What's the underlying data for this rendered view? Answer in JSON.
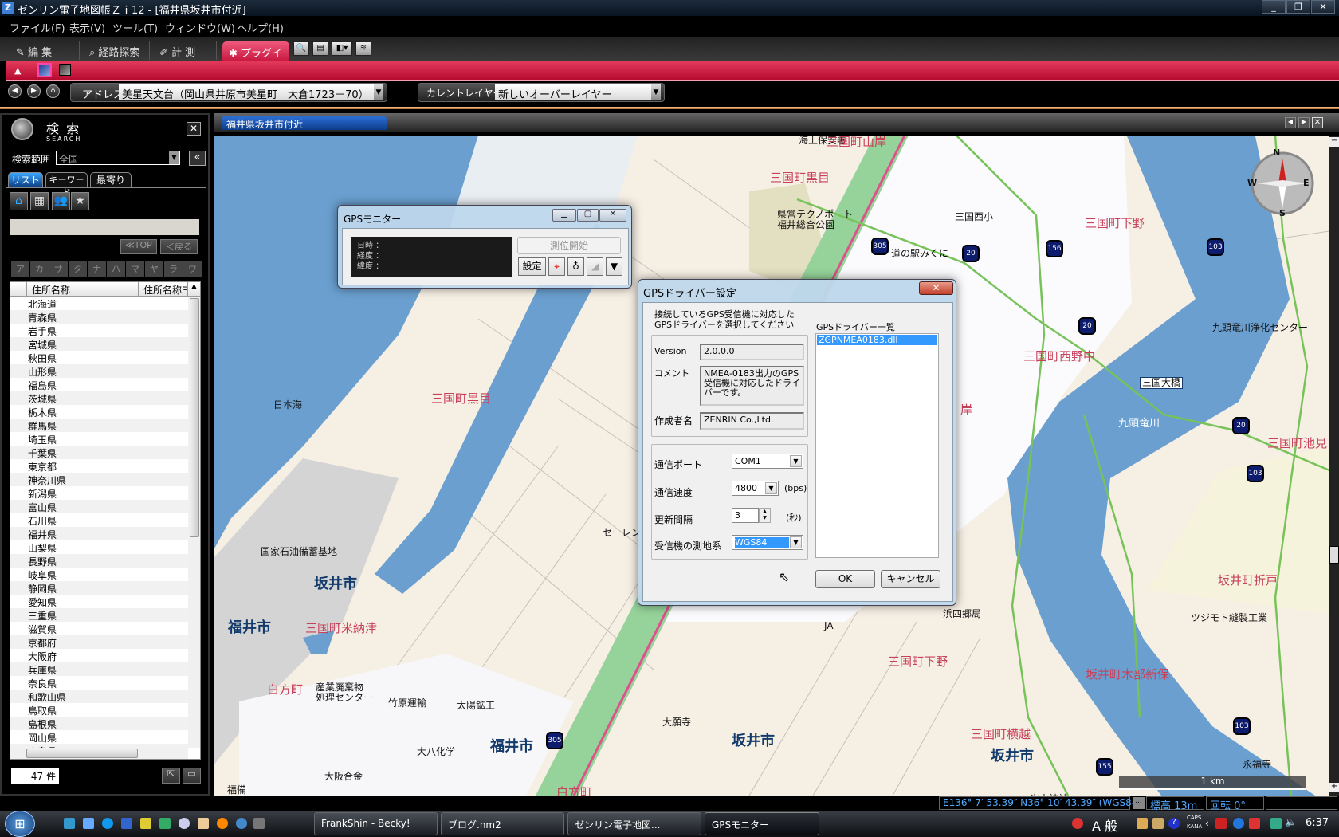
{
  "window": {
    "title": "ゼンリン電子地図帳Ｚｉ12 - [福井県坂井市付近]",
    "app_icon": "Z"
  },
  "menu": [
    "ファイル(F)",
    "表示(V)",
    "ツール(T)",
    "ウィンドウ(W)",
    "ヘルプ(H)"
  ],
  "toolbar": {
    "tabs": [
      "編 集",
      "経路探索",
      "計 測",
      "プラグイン"
    ],
    "active_tab": "プラグイン"
  },
  "address": {
    "label": "アドレス",
    "value": "美星天文台（岡山県井原市美星町　大倉1723－70）"
  },
  "layer": {
    "label": "カレントレイヤー",
    "value": "新しいオーバーレイヤー"
  },
  "search_panel": {
    "title": "検 索",
    "subtitle": "SEARCH",
    "scope_label": "検索範囲",
    "scope_value": "全国",
    "tabs": [
      "リスト",
      "キーワード",
      "最寄り"
    ],
    "top_button": "≪TOP",
    "back_button": "＜戻る",
    "kana": [
      "ア",
      "カ",
      "サ",
      "タ",
      "ナ",
      "ハ",
      "マ",
      "ヤ",
      "ラ",
      "ワ"
    ],
    "columns": [
      "住所名称",
      "住所名称ヨ"
    ],
    "rows": [
      "北海道",
      "青森県",
      "岩手県",
      "宮城県",
      "秋田県",
      "山形県",
      "福島県",
      "茨城県",
      "栃木県",
      "群馬県",
      "埼玉県",
      "千葉県",
      "東京都",
      "神奈川県",
      "新潟県",
      "富山県",
      "石川県",
      "福井県",
      "山梨県",
      "長野県",
      "岐阜県",
      "静岡県",
      "愛知県",
      "三重県",
      "滋賀県",
      "京都府",
      "大阪府",
      "兵庫県",
      "奈良県",
      "和歌山県",
      "鳥取県",
      "島根県",
      "岡山県",
      "広島県"
    ],
    "count": "47 件"
  },
  "map": {
    "tab": "福井県坂井市付近",
    "labels": [
      "海上保安署",
      "三国町山岸",
      "三国町黒目",
      "県営テクノポート",
      "福井総合公園",
      "道の駅みくに",
      "三国西小",
      "三国町下野",
      "九頭竜川浄化センター",
      "三国町西野中",
      "三国大橋",
      "九頭竜川",
      "三国町池見",
      "日本海",
      "三国町黒目",
      "国家石油備蓄基地",
      "セーレン電",
      "坂井市",
      "福井市",
      "三国町米納津",
      "白方町",
      "産業廃棄物",
      "処理センター",
      "竹原運輸",
      "太陽鉱工",
      "大八化学",
      "大阪合金",
      "福備",
      "福井市",
      "白方町",
      "大願寺",
      "坂井市",
      "三国町下野",
      "浜四郷局",
      "JA",
      "三国町横越",
      "坂井市",
      "坂井町折戸",
      "ツジモト縫製工業",
      "坂井町木部新保",
      "永福寺",
      "氷山神社",
      "岸"
    ],
    "route_shields": [
      "305",
      "20",
      "156",
      "103",
      "20",
      "20",
      "103",
      "103",
      "155",
      "305"
    ],
    "scale": "1 km",
    "compass": [
      "N",
      "E",
      "S",
      "W"
    ]
  },
  "gps_monitor": {
    "title": "GPSモニター",
    "fields": [
      "日時 ：",
      "経度 ：",
      "緯度 ："
    ],
    "start_button": "測位開始",
    "settings_button": "設定"
  },
  "driver_dialog": {
    "title": "GPSドライバー設定",
    "instruction": [
      "接続しているGPS受信機に対応した",
      "GPSドライバーを選択してください"
    ],
    "version_label": "Version",
    "version": "2.0.0.0",
    "comment_label": "コメント",
    "comment": "NMEA-0183出力のGPS受信機に対応したドライバーです。",
    "author_label": "作成者名",
    "author": "ZENRIN Co.,Ltd.",
    "port_label": "通信ポート",
    "port": "COM1",
    "speed_label": "通信速度",
    "speed": "4800",
    "speed_unit": "(bps)",
    "interval_label": "更新間隔",
    "interval": "3",
    "interval_unit": "(秒)",
    "datum_label": "受信機の測地系",
    "datum": "WGS84",
    "list_label": "GPSドライバー一覧",
    "drivers": [
      "ZGPNMEA0183.dll"
    ],
    "ok": "OK",
    "cancel": "キャンセル"
  },
  "status": {
    "coords": "E136° 7′ 53.39″ N36° 10′ 43.39″ (WGS84)",
    "more": "...",
    "altitude": "標高 13m",
    "rotation": "回転 0°"
  },
  "taskbar": {
    "tasks": [
      "FrankShin - Becky!",
      "ブログ.nm2",
      "ゼンリン電子地図...",
      "GPSモニター"
    ],
    "active": "GPSモニター",
    "ime": "A 般",
    "caps": "CAPS",
    "kana": "KANA",
    "clock": "6:37"
  },
  "colors": {
    "accent_pink": "#c8163f",
    "selection": "#3399ff",
    "river": "#6a9fcf",
    "park": "#95d39a"
  }
}
